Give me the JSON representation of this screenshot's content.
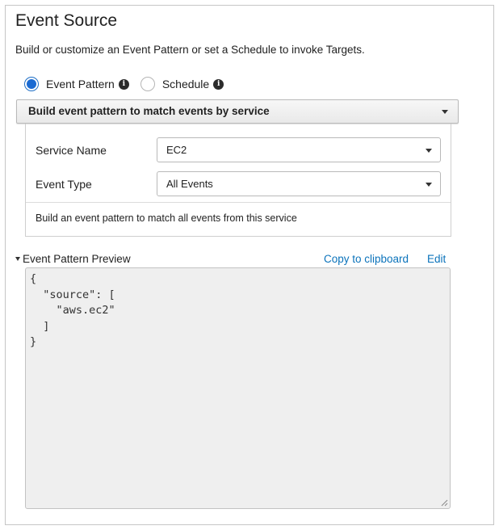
{
  "panel": {
    "title": "Event Source",
    "description": "Build or customize an Event Pattern or set a Schedule to invoke Targets."
  },
  "source_type": {
    "options": [
      {
        "label": "Event Pattern",
        "selected": true
      },
      {
        "label": "Schedule",
        "selected": false
      }
    ]
  },
  "pattern_mode": {
    "selected": "Build event pattern to match events by service"
  },
  "fields": {
    "service_name": {
      "label": "Service Name",
      "value": "EC2"
    },
    "event_type": {
      "label": "Event Type",
      "value": "All Events"
    }
  },
  "note": "Build an event pattern to match all events from this service",
  "preview": {
    "toggle_label": "Event Pattern Preview",
    "copy_label": "Copy to clipboard",
    "edit_label": "Edit",
    "code": "{\n  \"source\": [\n    \"aws.ec2\"\n  ]\n}"
  },
  "colors": {
    "accent": "#1a6ad2",
    "link": "#0b73bb",
    "border": "#c6c6c6"
  },
  "icons": {
    "info": "info-icon",
    "caret": "chevron-down-icon",
    "resize": "resize-handle-icon"
  }
}
